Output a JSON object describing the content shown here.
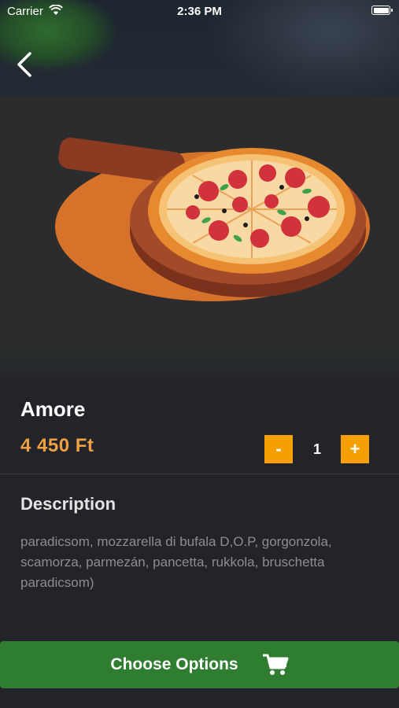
{
  "status_bar": {
    "carrier": "Carrier",
    "time": "2:36 PM"
  },
  "product": {
    "name": "Amore",
    "price": "4 450 Ft",
    "quantity": "1",
    "decrement_label": "-",
    "increment_label": "+"
  },
  "description": {
    "heading": "Description",
    "text": "paradicsom, mozzarella di bufala D,O.P, gorgonzola, scamorza, parmezán, pancetta, rukkola, bruschetta paradicsom)"
  },
  "cta": {
    "label": "Choose Options",
    "icon": "cart-icon"
  },
  "colors": {
    "accent": "#f5a000",
    "price": "#f0a042",
    "cta": "#2f7d31",
    "background": "#23242a"
  }
}
